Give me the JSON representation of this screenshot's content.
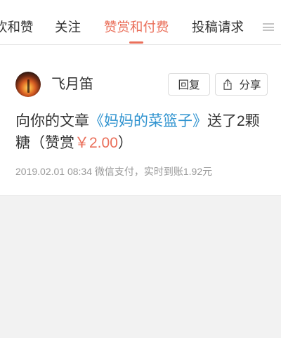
{
  "colors": {
    "accent": "#ea6f5a",
    "link": "#3194d0",
    "text": "#333333",
    "muted": "#999999",
    "page_background": "#f2f2f2"
  },
  "tabs": [
    {
      "label": "欢和赞",
      "active": false
    },
    {
      "label": "关注",
      "active": false
    },
    {
      "label": "赞赏和付费",
      "active": true
    },
    {
      "label": "投稿请求",
      "active": false
    }
  ],
  "header": {
    "menu_icon": "hamburger-menu-icon"
  },
  "notification": {
    "avatar_icon": "user-avatar",
    "user_name": "飞月笛",
    "reply_label": "回复",
    "share_icon": "share-icon",
    "share_label": "分享",
    "message": {
      "prefix": "向你的文章",
      "article_title": "《妈妈的菜篮子》",
      "middle": "送了2颗糖（赞赏",
      "amount": "￥2.00",
      "suffix": "）"
    },
    "meta": "2019.02.01 08:34 微信支付，实时到账1.92元"
  }
}
